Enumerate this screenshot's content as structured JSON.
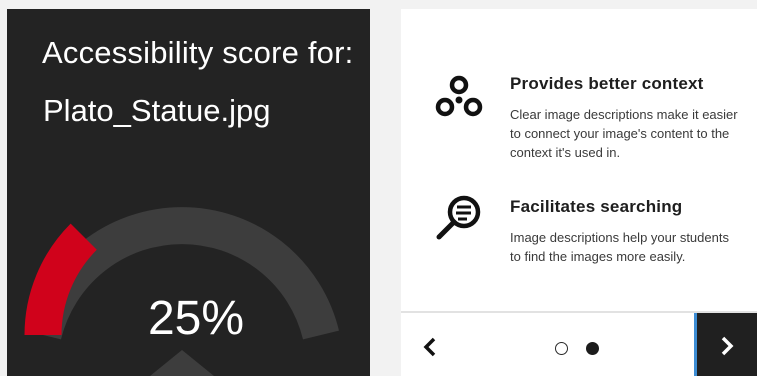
{
  "score_panel": {
    "heading": "Accessibility score for:",
    "file_name": "Plato_Statue.jpg",
    "score_text": "25%",
    "score_fraction": 0.25,
    "colors": {
      "fill": "#d0021b",
      "track": "#3d3d3d",
      "background": "#232323"
    }
  },
  "benefits": [
    {
      "icon": "connected-circles-icon",
      "title": "Provides better context",
      "description": "Clear image descriptions make it easier to connect your image's content to the context it's used in."
    },
    {
      "icon": "magnifying-glass-icon",
      "title": "Facilitates searching",
      "description": "Image descriptions help your students to find the images more easily."
    }
  ],
  "pagination": {
    "prev_icon": "chevron-left-icon",
    "next_icon": "chevron-right-icon",
    "pages": 2,
    "current_page": 2,
    "accent_color": "#3d8dd4"
  }
}
